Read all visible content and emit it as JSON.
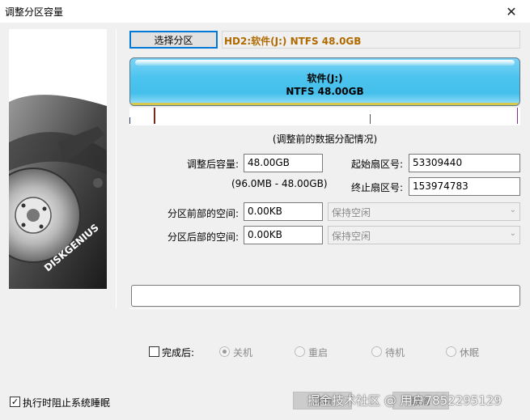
{
  "window": {
    "title": "调整分区容量",
    "close_glyph": "✕"
  },
  "logo": {
    "brand": "DISKGENIUS"
  },
  "toolbar": {
    "select_partition_label": "选择分区"
  },
  "partition": {
    "header": "HD2:软件(J:) NTFS 48.0GB",
    "name": "软件(J:)",
    "fs_size": "NTFS 48.00GB"
  },
  "caption": "(调整前的数据分配情况)",
  "form": {
    "size_label": "调整后容量:",
    "size_value": "48.00GB",
    "size_range": "(96.0MB - 48.00GB)",
    "start_sector_label": "起始扇区号:",
    "start_sector_value": "53309440",
    "end_sector_label": "终止扇区号:",
    "end_sector_value": "153974783",
    "free_before_label": "分区前部的空间:",
    "free_before_value": "0.00KB",
    "free_before_option": "保持空闲",
    "free_after_label": "分区后部的空间:",
    "free_after_value": "0.00KB",
    "free_after_option": "保持空闲"
  },
  "after_complete": {
    "label": "完成后:",
    "checked": false,
    "options": [
      "关机",
      "重启",
      "待机",
      "休眠"
    ],
    "selected": "关机"
  },
  "prevent_sleep": {
    "label": "执行时阻止系统睡眠",
    "checked": true
  },
  "buttons": {
    "start_label": "开始",
    "cancel_label": "取消"
  },
  "watermark": "掘金技术社区 @ 用户7852295129",
  "colors": {
    "accent": "#0078d7",
    "partition_fill": "#4cc4ef",
    "header_text": "#b06a00"
  }
}
